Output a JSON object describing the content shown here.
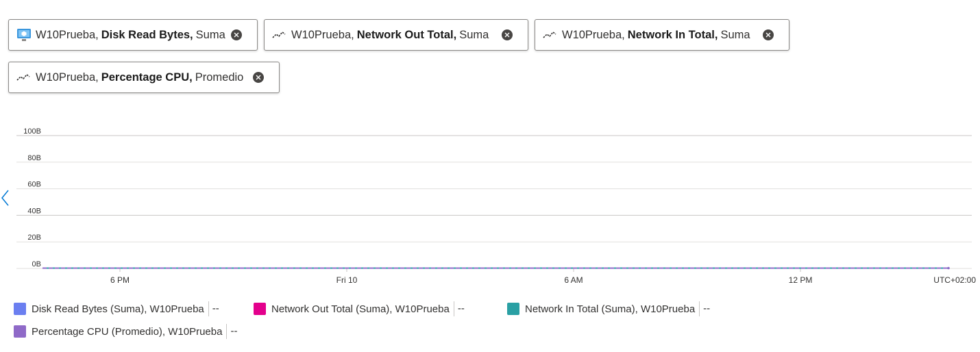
{
  "pills": [
    {
      "resource": "W10Prueba",
      "metric": "Disk Read Bytes",
      "aggregation": "Suma",
      "icon": "vm-monitor-icon"
    },
    {
      "resource": "W10Prueba",
      "metric": "Network Out Total",
      "aggregation": "Suma",
      "icon": "metric-line-icon"
    },
    {
      "resource": "W10Prueba",
      "metric": "Network In Total",
      "aggregation": "Suma",
      "icon": "metric-line-icon"
    },
    {
      "resource": "W10Prueba",
      "metric": "Percentage CPU",
      "aggregation": "Promedio",
      "icon": "metric-line-icon"
    }
  ],
  "chart_data": {
    "type": "line",
    "yticks": [
      "0B",
      "20B",
      "40B",
      "60B",
      "80B",
      "100B"
    ],
    "ylim": [
      0,
      100
    ],
    "xticks": [
      "6 PM",
      "Fri 10",
      "6 AM",
      "12 PM"
    ],
    "timezone": "UTC+02:00",
    "grid": true,
    "series": [
      {
        "name": "Disk Read Bytes (Suma), W10Prueba",
        "color": "#6b7ff0",
        "values": [
          0,
          0
        ]
      },
      {
        "name": "Network Out Total (Suma), W10Prueba",
        "color": "#e3008c",
        "values": [
          0,
          0
        ]
      },
      {
        "name": "Network In Total (Suma), W10Prueba",
        "color": "#2aa0a4",
        "values": [
          0,
          0
        ]
      },
      {
        "name": "Percentage CPU (Promedio), W10Prueba",
        "color": "#8f6ac8",
        "values": [
          0,
          0
        ]
      }
    ]
  },
  "legend": [
    {
      "label": "Disk Read Bytes (Suma), W10Prueba",
      "color": "#6b7ff0",
      "value": "--"
    },
    {
      "label": "Network Out Total (Suma), W10Prueba",
      "color": "#e3008c",
      "value": "--"
    },
    {
      "label": "Network In Total (Suma), W10Prueba",
      "color": "#2aa0a4",
      "value": "--"
    },
    {
      "label": "Percentage CPU (Promedio), W10Prueba",
      "color": "#8f6ac8",
      "value": "--"
    }
  ],
  "colors": {
    "accent": "#0078d4"
  }
}
